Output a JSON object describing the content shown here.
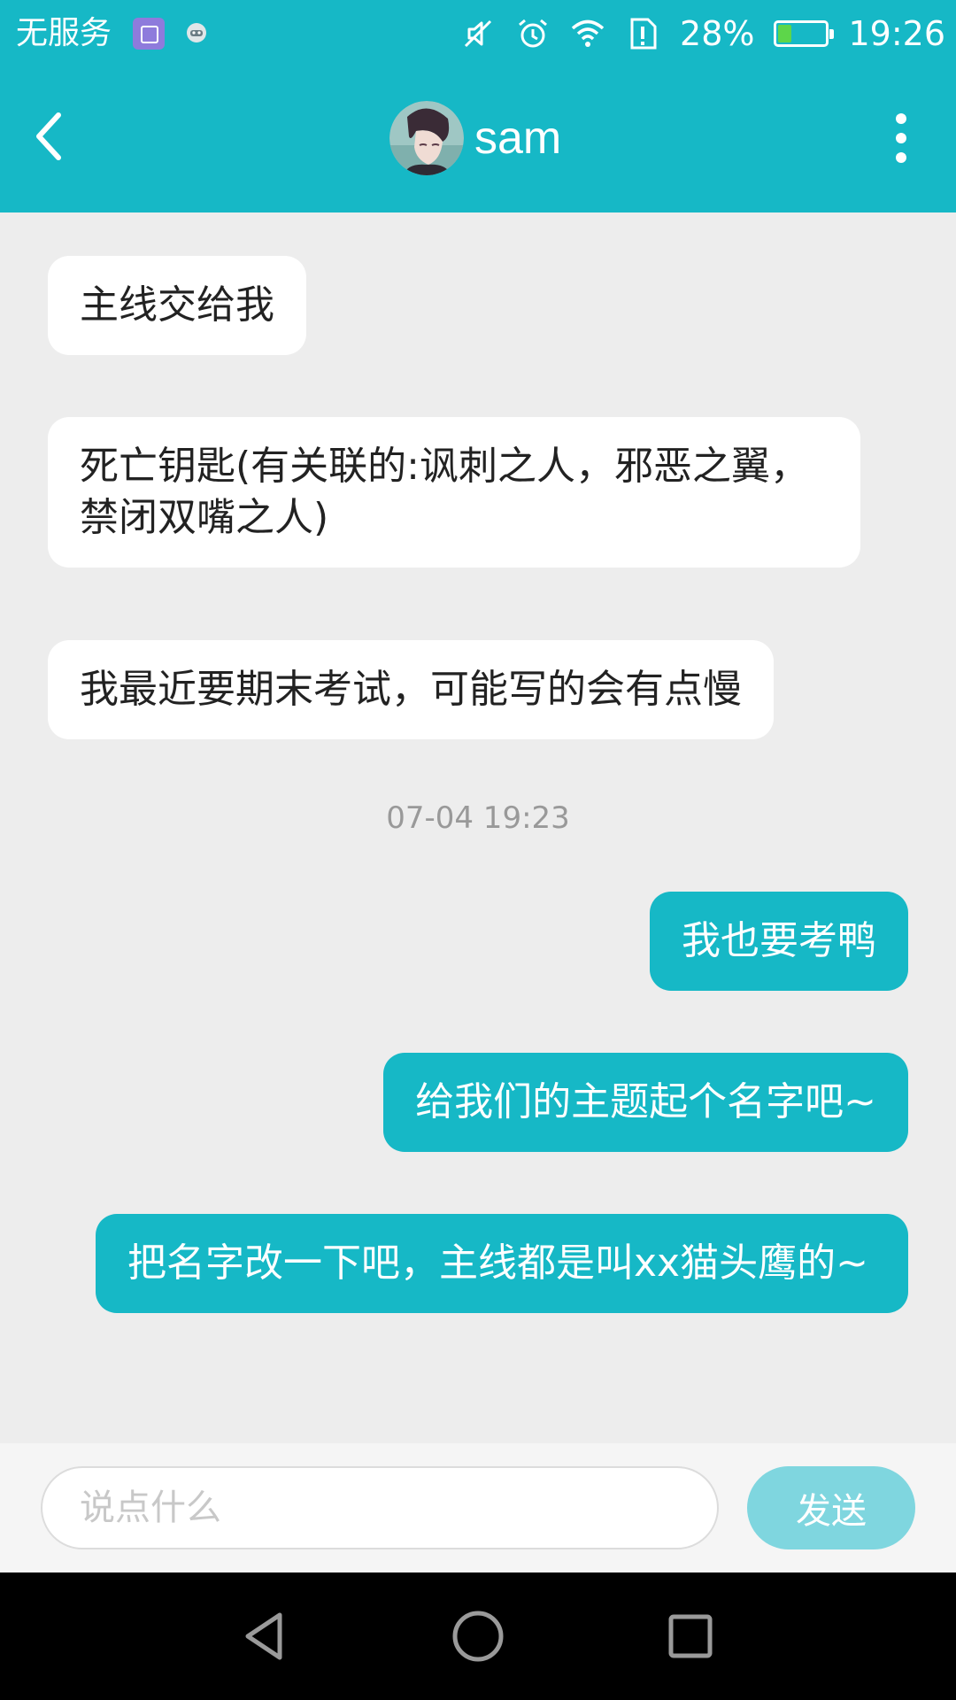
{
  "status_bar": {
    "carrier": "无服务",
    "battery_percent": "28%",
    "time": "19:26",
    "battery_level": 0.28,
    "icons": [
      "gallery-app-icon",
      "robot-app-icon",
      "mute-icon",
      "alarm-icon",
      "wifi-icon",
      "sim-alert-icon",
      "battery-icon"
    ]
  },
  "header": {
    "contact_name": "sam",
    "back_icon": "chevron-left-icon",
    "more_icon": "more-vertical-icon",
    "color": "#16b8c6"
  },
  "messages": [
    {
      "side": "left",
      "text": "主线交给我"
    },
    {
      "side": "left",
      "text": "死亡钥匙(有关联的:讽刺之人，邪恶之翼，禁闭双嘴之人)"
    },
    {
      "side": "left",
      "text": "我最近要期末考试，可能写的会有点慢"
    },
    {
      "side": "right",
      "text": "我也要考鸭"
    },
    {
      "side": "right",
      "text": "给我们的主题起个名字吧~"
    },
    {
      "side": "right",
      "text": "把名字改一下吧，主线都是叫xx猫头鹰的~"
    }
  ],
  "timestamp": "07-04 19:23",
  "input": {
    "placeholder": "说点什么",
    "value": ""
  },
  "send_button": {
    "label": "发送"
  },
  "nav_bar": {
    "icons": [
      "back-triangle-icon",
      "home-circle-icon",
      "recents-square-icon"
    ]
  }
}
